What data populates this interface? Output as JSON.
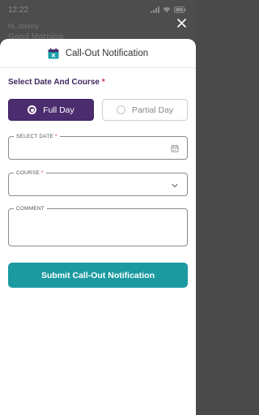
{
  "status_bar": {
    "time": "12:22"
  },
  "background": {
    "greeting": "Hi, Johnny",
    "subgreeting": "Good Morning"
  },
  "sheet": {
    "title": "Call-Out Notification",
    "section_label": "Select Date And Course",
    "required_mark": "*",
    "options": [
      {
        "label": "Full Day",
        "selected": true
      },
      {
        "label": "Partial Day",
        "selected": false
      }
    ],
    "fields": {
      "date_label": "SELECT DATE",
      "course_label": "COURSE",
      "comment_label": "COMMENT"
    },
    "submit_label": "Submit Call-Out Notification"
  },
  "colors": {
    "primary_purple": "#4b2c6e",
    "teal": "#1b9aa0",
    "required": "#e0245e"
  }
}
